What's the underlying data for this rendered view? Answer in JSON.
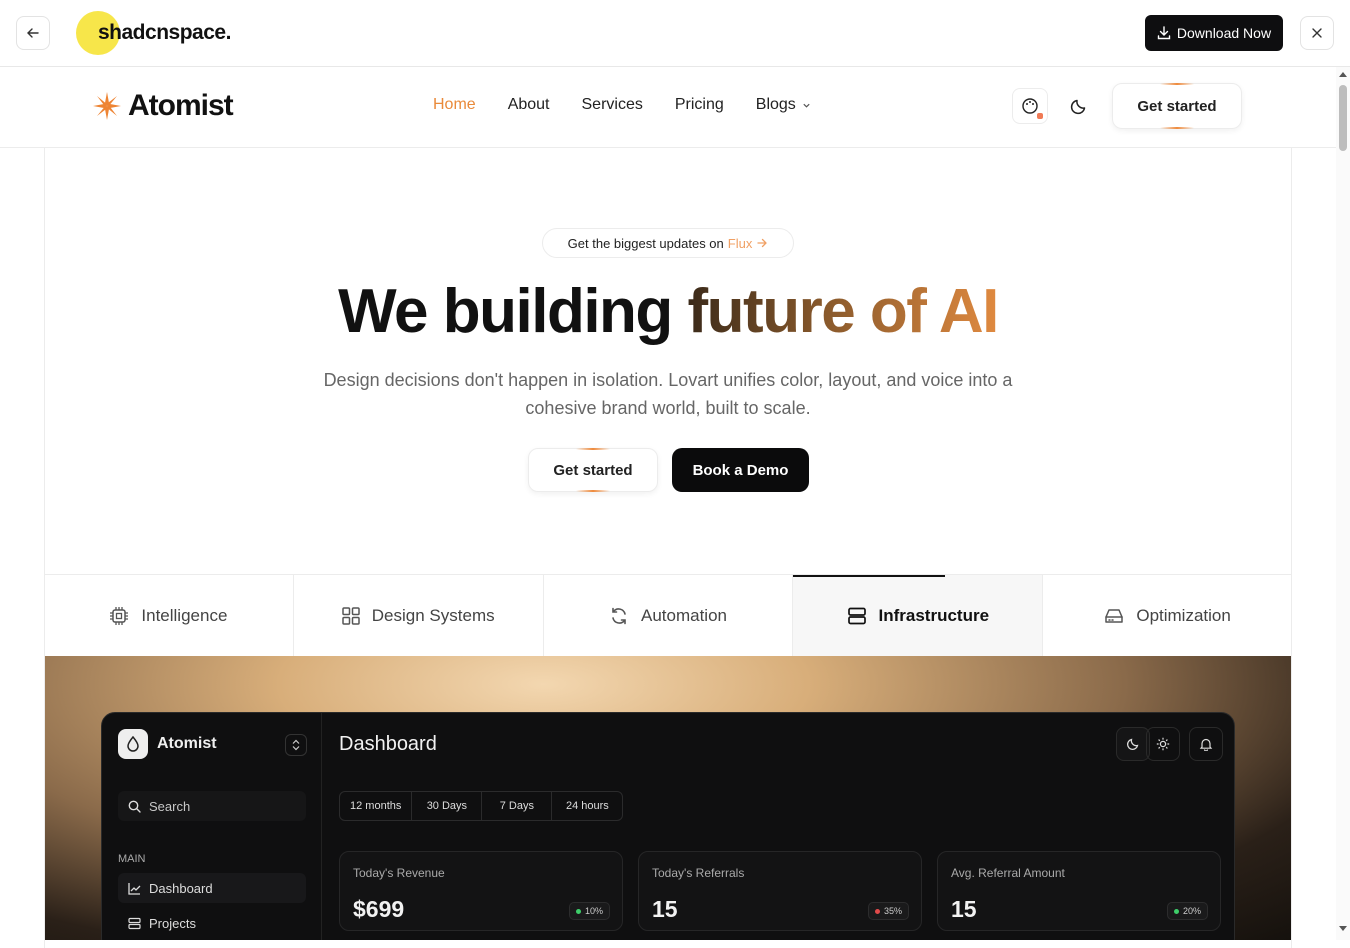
{
  "preview_bar": {
    "brand": "shadcnspace.",
    "download_label": "Download Now",
    "back_icon": "arrow-left-icon",
    "close_icon": "close-icon"
  },
  "nav": {
    "logo_text": "Atomist",
    "links": [
      {
        "label": "Home",
        "active": true
      },
      {
        "label": "About"
      },
      {
        "label": "Services"
      },
      {
        "label": "Pricing"
      },
      {
        "label": "Blogs"
      }
    ],
    "cta_label": "Get started",
    "accent_color": "#e98a3a"
  },
  "hero": {
    "pill_text": "Get the biggest updates on",
    "pill_link": "Flux",
    "title_plain": "We building",
    "title_gradient": "future of AI",
    "subtitle": "Design decisions don't happen in isolation. Lovart unifies color, layout, and voice into a cohesive brand world, built to scale.",
    "primary_cta": "Get started",
    "secondary_cta": "Book a Demo"
  },
  "tabs": [
    {
      "label": "Intelligence",
      "icon": "chip-icon"
    },
    {
      "label": "Design Systems",
      "icon": "grid-icon"
    },
    {
      "label": "Automation",
      "icon": "refresh-icon"
    },
    {
      "label": "Infrastructure",
      "icon": "server-icon",
      "active": true
    },
    {
      "label": "Optimization",
      "icon": "drive-icon"
    }
  ],
  "dashboard": {
    "workspace": "Atomist",
    "title": "Dashboard",
    "search_label": "Search",
    "section_label": "MAIN",
    "items": [
      "Dashboard",
      "Projects"
    ],
    "ranges": [
      "12 months",
      "30 Days",
      "7 Days",
      "24 hours"
    ],
    "cards": [
      {
        "label": "Today's Revenue",
        "value": "$699",
        "badge": "10%",
        "badge_color": "#3ecf6a"
      },
      {
        "label": "Today's Referrals",
        "value": "15",
        "badge": "35%",
        "badge_color": "#e24a4a"
      },
      {
        "label": "Avg. Referral Amount",
        "value": "15",
        "badge": "20%",
        "badge_color": "#3ecf6a"
      }
    ]
  }
}
